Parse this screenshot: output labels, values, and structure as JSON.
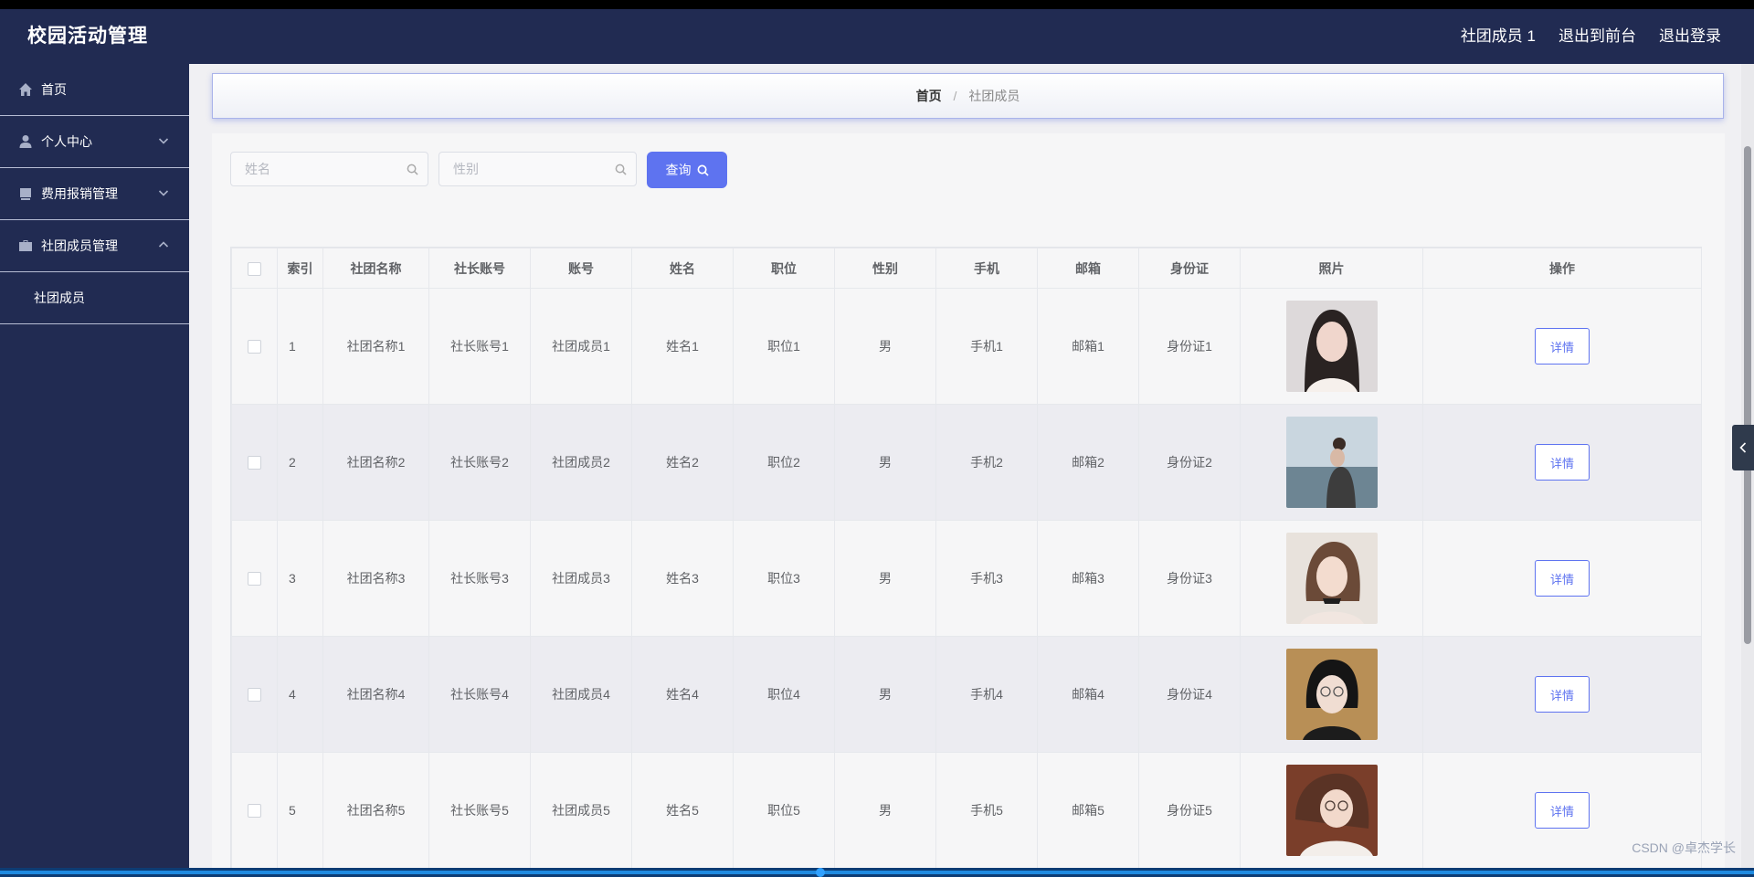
{
  "app": {
    "title": "校园活动管理"
  },
  "topbar": {
    "user": "社团成员 1",
    "to_front": "退出到前台",
    "logout": "退出登录"
  },
  "sidebar": {
    "items": [
      {
        "label": "首页",
        "icon": "home-icon"
      },
      {
        "label": "个人中心",
        "icon": "user-icon"
      },
      {
        "label": "费用报销管理",
        "icon": "document-icon"
      },
      {
        "label": "社团成员管理",
        "icon": "briefcase-icon"
      }
    ],
    "submenu": [
      {
        "label": "社团成员"
      }
    ]
  },
  "breadcrumb": {
    "home": "首页",
    "separator": "/",
    "current": "社团成员"
  },
  "search": {
    "name_placeholder": "姓名",
    "gender_placeholder": "性别",
    "query_label": "查询"
  },
  "table": {
    "headers": [
      "",
      "索引",
      "社团名称",
      "社长账号",
      "账号",
      "姓名",
      "职位",
      "性别",
      "手机",
      "邮箱",
      "身份证",
      "照片",
      "操作"
    ],
    "rows": [
      {
        "index": "1",
        "club_name": "社团名称1",
        "leader_account": "社长账号1",
        "account": "社团成员1",
        "name": "姓名1",
        "position": "职位1",
        "gender": "男",
        "phone": "手机1",
        "email": "邮箱1",
        "id_card": "身份证1",
        "action": "详情"
      },
      {
        "index": "2",
        "club_name": "社团名称2",
        "leader_account": "社长账号2",
        "account": "社团成员2",
        "name": "姓名2",
        "position": "职位2",
        "gender": "男",
        "phone": "手机2",
        "email": "邮箱2",
        "id_card": "身份证2",
        "action": "详情"
      },
      {
        "index": "3",
        "club_name": "社团名称3",
        "leader_account": "社长账号3",
        "account": "社团成员3",
        "name": "姓名3",
        "position": "职位3",
        "gender": "男",
        "phone": "手机3",
        "email": "邮箱3",
        "id_card": "身份证3",
        "action": "详情"
      },
      {
        "index": "4",
        "club_name": "社团名称4",
        "leader_account": "社长账号4",
        "account": "社团成员4",
        "name": "姓名4",
        "position": "职位4",
        "gender": "男",
        "phone": "手机4",
        "email": "邮箱4",
        "id_card": "身份证4",
        "action": "详情"
      },
      {
        "index": "5",
        "club_name": "社团名称5",
        "leader_account": "社长账号5",
        "account": "社团成员5",
        "name": "姓名5",
        "position": "职位5",
        "gender": "男",
        "phone": "手机5",
        "email": "邮箱5",
        "id_card": "身份证5",
        "action": "详情"
      }
    ]
  },
  "watermark": "CSDN @卓杰学长",
  "colors": {
    "nav_bg": "#212b52",
    "accent": "#5e73f0",
    "content_bg": "#f6f6f7"
  }
}
